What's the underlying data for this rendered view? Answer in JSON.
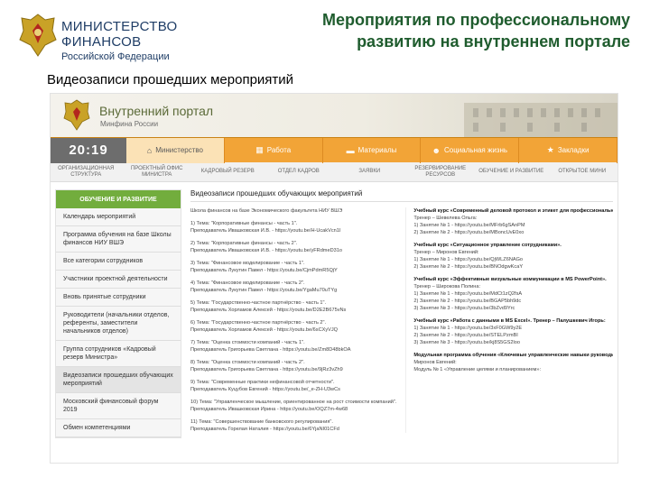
{
  "header": {
    "ministry_line1": "МИНИСТЕРСТВО",
    "ministry_line2": "ФИНАНСОВ",
    "ministry_line3": "Российской Федерации",
    "title": "Мероприятия по профессиональному развитию на внутреннем портале"
  },
  "subtitle": "Видеозаписи прошедших мероприятий",
  "portal": {
    "title": "Внутренний портал",
    "subtitle": "Минфина России",
    "time": "20:19",
    "tabs": [
      {
        "label": "Министерство",
        "icon": "home-icon"
      },
      {
        "label": "Работа",
        "icon": "calendar-icon"
      },
      {
        "label": "Материалы",
        "icon": "folder-icon"
      },
      {
        "label": "Социальная жизнь",
        "icon": "people-icon"
      },
      {
        "label": "Закладки",
        "icon": "star-icon"
      }
    ],
    "subnav": [
      "ОРГАНИЗАЦИОННАЯ СТРУКТУРА",
      "ПРОЕКТНЫЙ ОФИС МИНИСТРА",
      "КАДРОВЫЙ РЕЗЕРВ",
      "ОТДЕЛ КАДРОВ",
      "ЗАЯВКИ",
      "РЕЗЕРВИРОВАНИЕ РЕСУРСОВ",
      "ОБУЧЕНИЕ И РАЗВИТИЕ",
      "ОТКРЫТОЕ МИНИ"
    ],
    "side_title": "ОБУЧЕНИЕ И РАЗВИТИЕ",
    "side_items": [
      "Календарь мероприятий",
      "Программа обучения на базе Школы финансов НИУ ВШЭ",
      "Все категории сотрудников",
      "Участники проектной деятельности",
      "Вновь принятые сотрудники",
      "Руководители (начальники отделов, референты, заместители начальников отделов)",
      "Группа сотрудников «Кадровый резерв Министра»",
      "Видеозаписи прошедших обучающих мероприятий",
      "Московский финансовый форум 2019",
      "Обмен компетенциями"
    ],
    "main_title": "Видеозаписи прошедших обучающих мероприятий",
    "left_lines": [
      "Школа финансов на базе Экономического факультета НИУ ВШЭ",
      "1) Тема: \"Корпоративные финансы - часть 1\".",
      "Преподаватель Ивашковская И.В. - https://youtu.be/H-UcakVcn1I",
      "2) Тема: \"Корпоративные финансы - часть 2\".",
      "Преподаватель Ивашковская И.В. - https://youtu.be/yFRdmeD31o",
      "3) Тема: \"Финансовое моделирование - часть 1\".",
      "Преподаватель Лукутин Павел - https://youtu.be/CjmPdmR5QjY",
      "4) Тема: \"Финансовое моделирование - часть 2\".",
      "Преподаватель Лукутин Павел - https://youtu.be/YgaMu70uTYg",
      "5) Тема: \"Государственно-частное партнёрство - часть 1\".",
      "Преподаватель Хорламов Алексей - https://youtu.be/D2E2B675vNs",
      "6) Тема: \"Государственно-частное партнёрство - часть 2\".",
      "Преподаватель Хорламов Алексей - https://youtu.be/6sCXyVJQ",
      "7) Тема: \"Оценка стоимости компаний - часть 1\".",
      "Преподаватель Григорьева Светлана - https://youtu.be/Zm8D48bkOA",
      "8) Тема: \"Оценка стоимости компаний - часть 2\".",
      "Преподаватель Григорьева Светлана - https://youtu.be/9jRz3vZh9",
      "9) Тема: \"Современные практики нефинансовой отчетности\".",
      "Преподаватель Куцубов Евгений - https://youtu.be/_e-ZH-U3wCs",
      "10) Тема: \"Управленческое мышление, ориентированное на рост стоимости компаний\".",
      "Преподаватель Ивашковская Ирина - https://youtu.be/OQZ7m-4w68",
      "11) Тема: \"Совершенствование банковского регулирования\".",
      "Преподаватель Горелая Наталия - https://youtu.be/6YjaNI01CFd"
    ],
    "right_lines": [
      "Учебный курс «Современный деловой протокол и этикет для профессионального успеха».",
      "Тренер – Шевелева Ольга:",
      "1) Занятие № 1 - https://youtu.be/MFrb6gSAnPM",
      "2) Занятие № 2 - https://youtu.be/MBoncUvE0xo",
      "Учебный курс «Ситуационное управление сотрудниками».",
      "Тренер – Миронов Евгений:",
      "1) Занятие № 1 - https://youtu.be/QjWLZ6NAGo",
      "2) Занятие № 2 - https://youtu.be/BNOdgwKcaY",
      "Учебный курс «Эффективные визуальные коммуникации в MS PowerPoint».",
      "Тренер – Широкова Полина:",
      "1) Занятие № 1 - https://youtu.be/MdCt1zQ2fsA",
      "2) Занятие № 2 - https://youtu.be/BGAP5bh9dc",
      "3) Занятие № 3 - https://youtu.be/3bZvd9Yrc",
      "Учебный курс «Работа с данными в MS Excel». Тренер – Палушкевич Игорь:",
      "1) Занятие № 1 - https://youtu.be/3xF0GW9y2E",
      "2) Занятие № 2 - https://youtu.be/STELPzmBI",
      "3) Занятие № 3 - https://youtu.be/kj8S5GS2loo",
      "Модульная программа обучения «Ключевые управленческие навыки руководителя». Тренер –",
      "Миронов Евгений:",
      "Модуль № 1 «Управление целями и планированием»:"
    ]
  }
}
